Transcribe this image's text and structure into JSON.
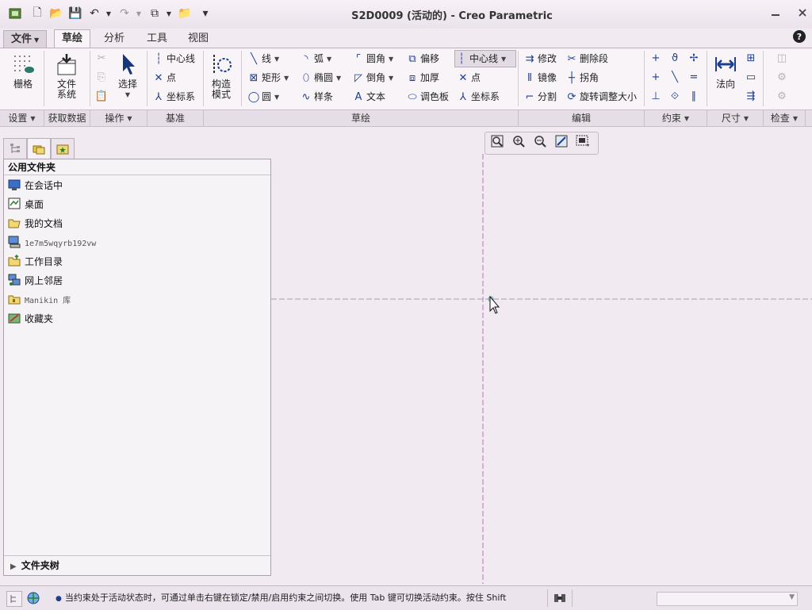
{
  "window": {
    "title": "S2D0009 (活动的) - Creo Parametric",
    "help": "?"
  },
  "quick_access": {
    "new": "🗋",
    "open": "📂",
    "save": "💾",
    "undo": "↶",
    "redo": "↷",
    "windows": "⧉",
    "close": "📁",
    "customize": "▾"
  },
  "menu_tabs": [
    "文件",
    "草绘",
    "分析",
    "工具",
    "视图"
  ],
  "ribbon": {
    "grid": "栅格",
    "file_system": [
      "文件",
      "系统"
    ],
    "select": "选择",
    "datum": [
      "中心线",
      "点",
      "坐标系"
    ],
    "construction_mode": [
      "构造",
      "模式"
    ],
    "sketch": {
      "col1": [
        "线",
        "矩形",
        "圆"
      ],
      "col2": [
        "弧",
        "椭圆",
        "样条"
      ],
      "col3": [
        "圆角",
        "倒角",
        "文本"
      ],
      "col4": [
        "偏移",
        "加厚",
        "调色板"
      ],
      "col5": [
        "中心线",
        "点",
        "坐标系"
      ]
    },
    "edit": {
      "col1": [
        "修改",
        "镜像",
        "分割"
      ],
      "col2": [
        "删除段",
        "拐角",
        "旋转调整大小"
      ]
    },
    "dimension": "法向"
  },
  "group_labels": [
    "设置",
    "获取数据",
    "操作",
    "基准",
    "草绘",
    "编辑",
    "约束",
    "尺寸",
    "检查"
  ],
  "left_panel": {
    "header": "公用文件夹",
    "items": [
      "在会话中",
      "桌面",
      "我的文档",
      "1e7m5wqyrb192vw",
      "工作目录",
      "网上邻居",
      "Manikin 库",
      "收藏夹"
    ],
    "folder_tree": "文件夹树"
  },
  "status": {
    "message": "当约束处于活动状态时，可通过单击右键在锁定/禁用/启用约束之间切换。使用 Tab 键可切换活动约束。按住 Shift"
  }
}
